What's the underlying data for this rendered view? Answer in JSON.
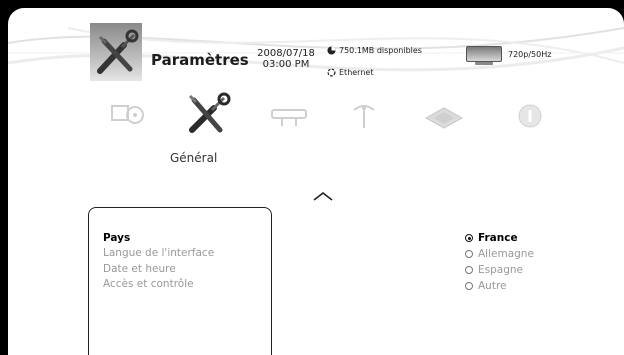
{
  "header": {
    "title": "Paramètres",
    "date": "2008/07/18",
    "time": "03:00 PM",
    "disk": "750.1MB disponibles",
    "network": "Ethernet",
    "video_mode": "720p/50Hz"
  },
  "categories": [
    {
      "name": "photo-music",
      "icon": "media-icon"
    },
    {
      "name": "general",
      "icon": "tools-icon",
      "label": "Général"
    },
    {
      "name": "playback",
      "icon": "connector-icon"
    },
    {
      "name": "network",
      "icon": "antenna-icon"
    },
    {
      "name": "system",
      "icon": "chip-icon"
    },
    {
      "name": "info",
      "icon": "info-icon"
    }
  ],
  "menu": {
    "items": [
      "Pays",
      "Langue de l'interface",
      "Date et heure",
      "Accès et contrôle"
    ],
    "selected_index": 0
  },
  "options": {
    "items": [
      "France",
      "Allemagne",
      "Espagne",
      "Autre"
    ],
    "selected_index": 0
  },
  "colors": {
    "background": "#ffffff",
    "frame": "#000000",
    "text_active": "#000000",
    "text_inactive": "#999999"
  }
}
